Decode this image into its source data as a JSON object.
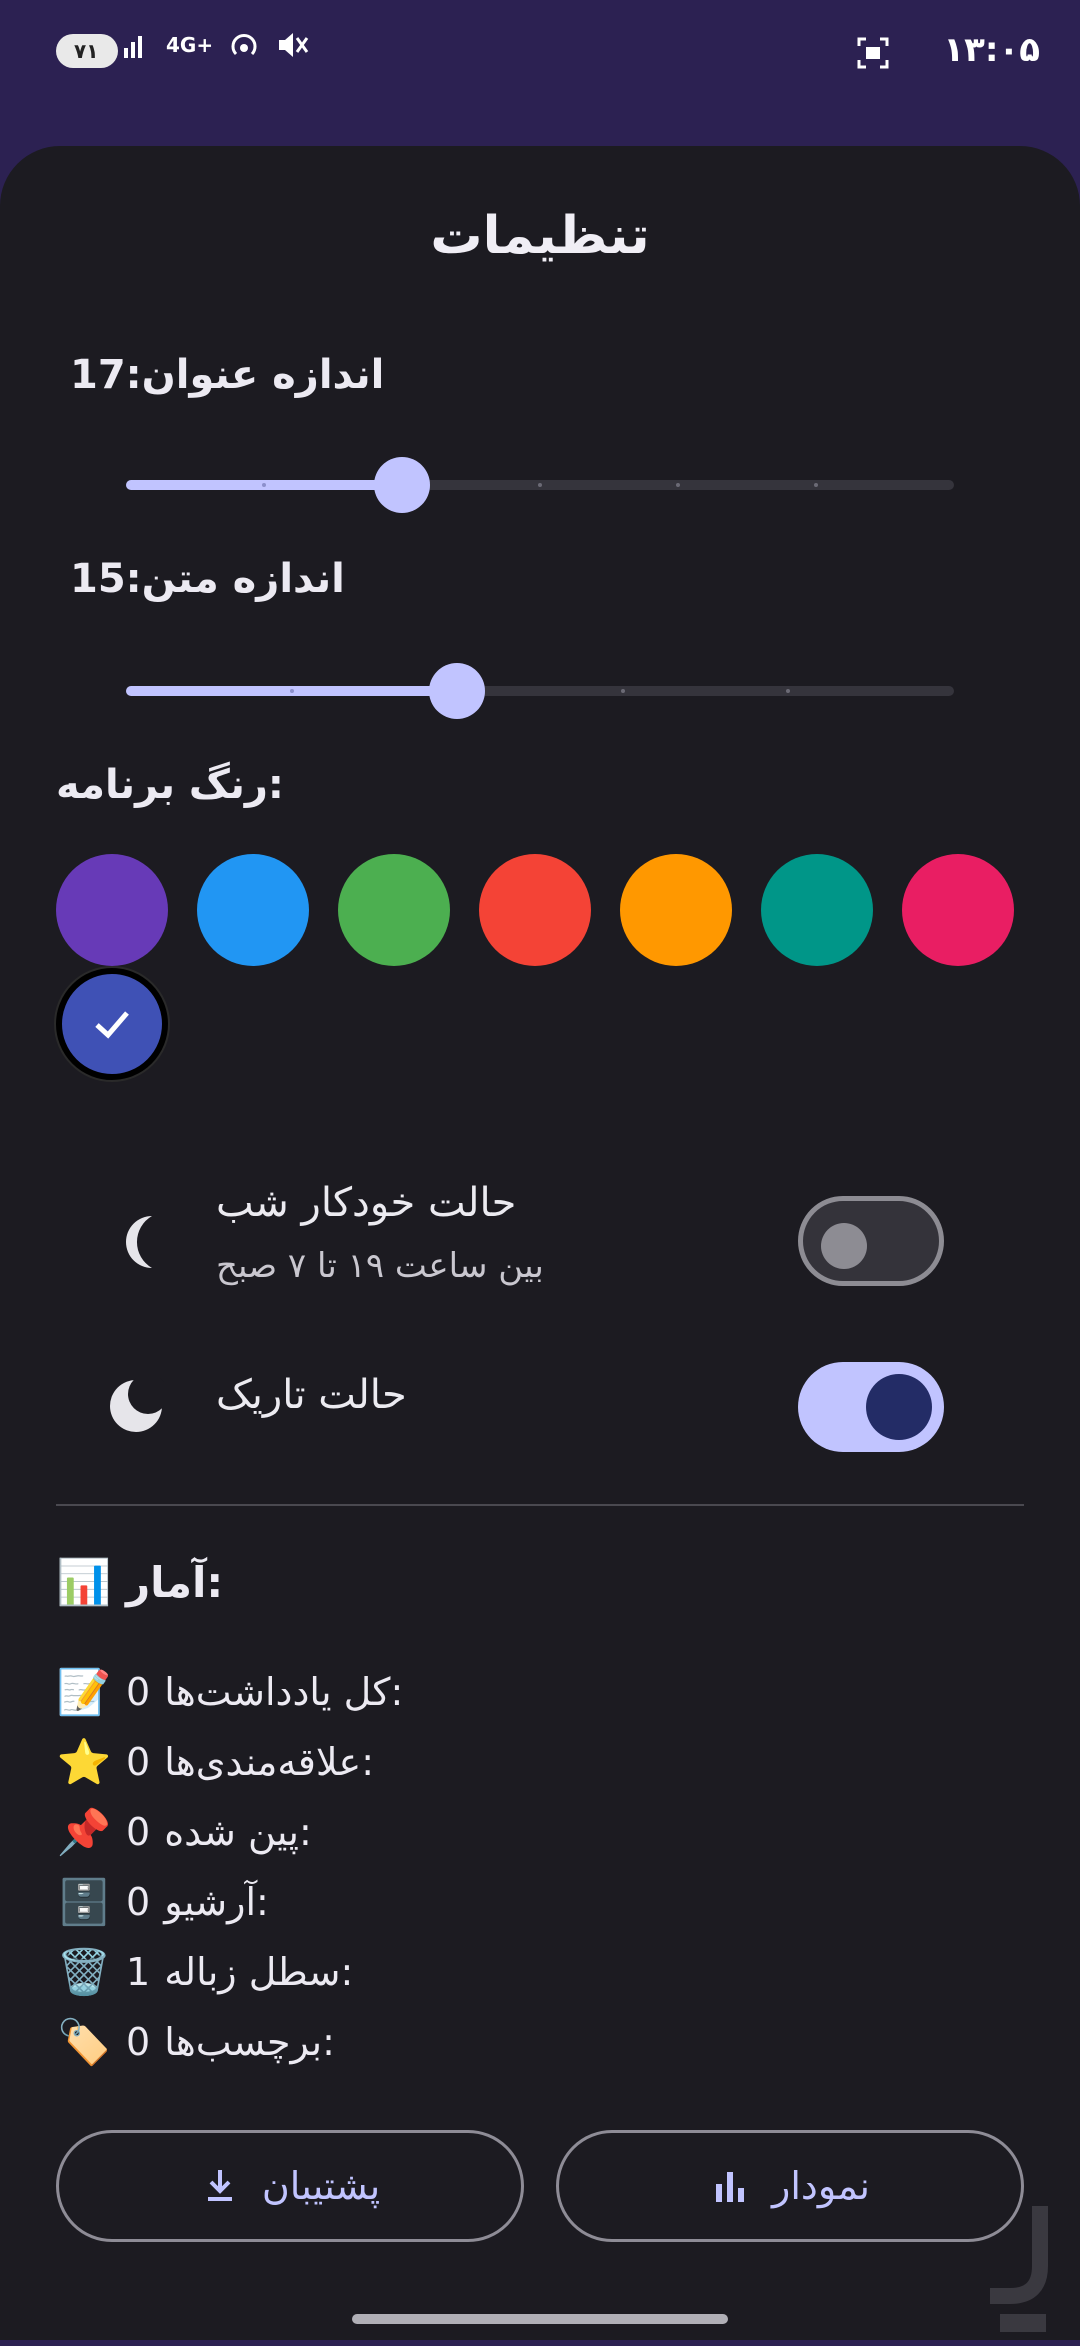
{
  "status_bar": {
    "time": "۱۳:۰۵",
    "battery": "۷۱",
    "network": "4G+"
  },
  "title": "تنظیمات",
  "title_size": {
    "label": "اندازه عنوان:",
    "value": "17",
    "level": 0.333
  },
  "text_size": {
    "label": "اندازه متن:",
    "value": "15",
    "level": 0.4
  },
  "app_color": {
    "label": "رنگ برنامه:",
    "colors": [
      "#673ab7",
      "#2196f3",
      "#4caf50",
      "#f44336",
      "#ff9800",
      "#009688",
      "#e91e63",
      "#3f51b5"
    ],
    "selected": "#3f51b5"
  },
  "auto_night": {
    "title": "حالت خودکار شب",
    "subtitle": "بین ساعت ۱۹ تا ۷ صبح",
    "enabled": false
  },
  "dark_mode": {
    "title": "حالت تاریک",
    "enabled": true
  },
  "stats": {
    "heading": "آمار:",
    "items": [
      {
        "label": "کل یادداشت‌ها:",
        "value": "0",
        "icon": "📝"
      },
      {
        "label": "علاقه‌مندی‌ها:",
        "value": "0",
        "icon": "⭐"
      },
      {
        "label": "پین شده:",
        "value": "0",
        "icon": "📌"
      },
      {
        "label": "آرشیو:",
        "value": "0",
        "icon": "🗄️"
      },
      {
        "label": "سطل زباله:",
        "value": "1",
        "icon": "🗑️"
      },
      {
        "label": "برچسب‌ها:",
        "value": "0",
        "icon": "🏷️"
      }
    ]
  },
  "buttons": {
    "chart": "نمودار",
    "backup": "پشتیبان"
  }
}
